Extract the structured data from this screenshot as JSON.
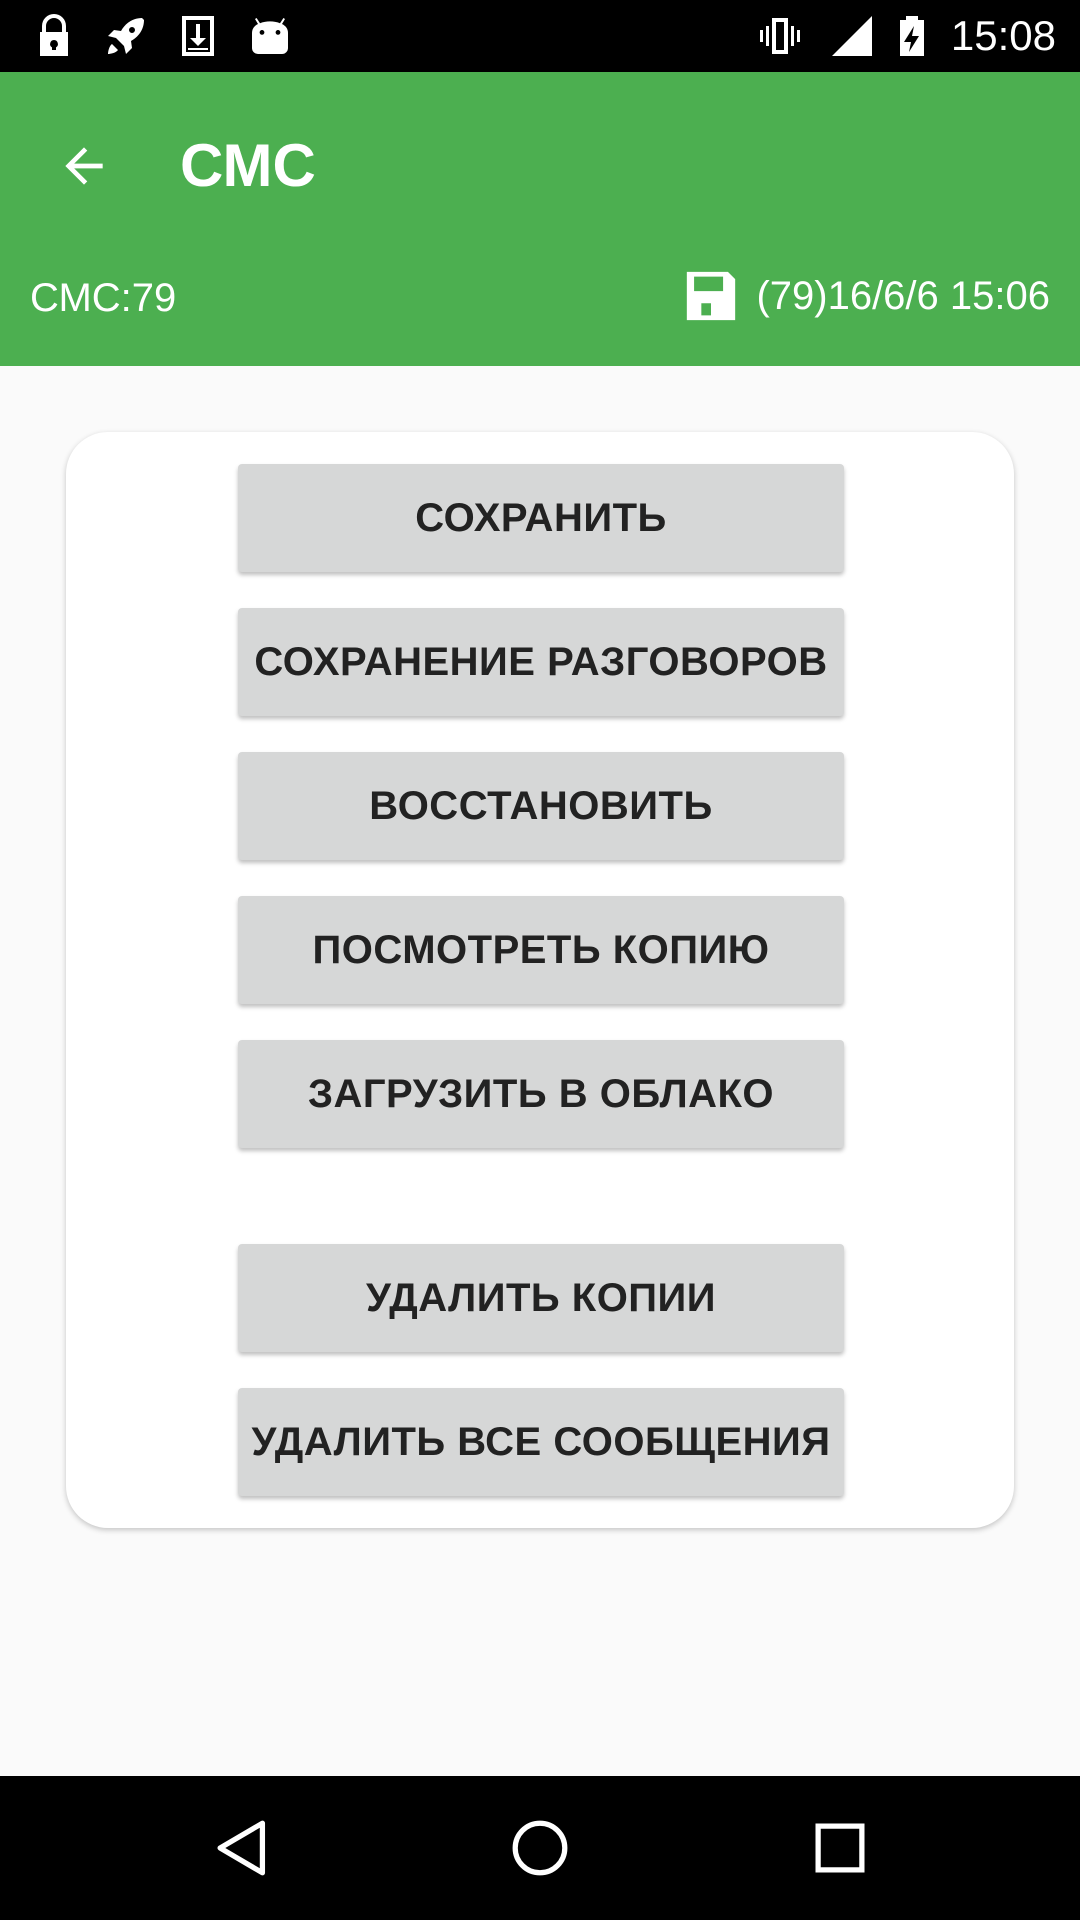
{
  "status_bar": {
    "time": "15:08",
    "left_icons": [
      "lock-icon",
      "rocket-icon",
      "download-icon",
      "android-icon"
    ],
    "right_icons": [
      "vibrate-icon",
      "signal-icon",
      "battery-charging-icon"
    ]
  },
  "app_bar": {
    "title": "СМС",
    "sms_count": "СМС:79",
    "backup_date": "(79)16/6/6 15:06",
    "color": "#4caf50"
  },
  "buttons": {
    "save": "СОХРАНИТЬ",
    "save_calls": "СОХРАНЕНИЕ РАЗГОВОРОВ",
    "restore": "ВОССТАНОВИТЬ",
    "view_copy": "ПОСМОТРЕТЬ КОПИЮ",
    "upload_cloud": "ЗАГРУЗИТЬ В ОБЛАКО",
    "delete_copies": "УДАЛИТЬ КОПИИ",
    "delete_all_messages": "УДАЛИТЬ ВСЕ СООБЩЕНИЯ"
  },
  "nav_bar": {
    "icons": [
      "back-triangle-icon",
      "home-circle-icon",
      "recents-square-icon"
    ]
  }
}
